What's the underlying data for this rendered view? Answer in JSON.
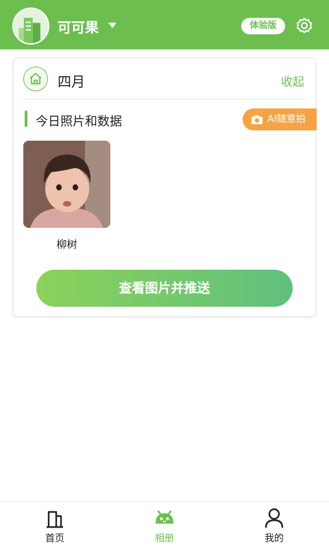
{
  "header": {
    "app_name": "可可果",
    "version_badge": "体验版"
  },
  "card": {
    "month_title": "四月",
    "collapse_label": "收起",
    "section_title": "今日照片和数据",
    "ai_button_label": "AI随意拍",
    "photos": [
      {
        "caption": "柳树"
      }
    ],
    "view_button_label": "查看图片并推送"
  },
  "bottom_nav": {
    "items": [
      {
        "label": "首页",
        "icon": "building-icon",
        "active": false
      },
      {
        "label": "相册",
        "icon": "mascot-icon",
        "active": true
      },
      {
        "label": "我的",
        "icon": "person-icon",
        "active": false
      }
    ]
  },
  "colors": {
    "brand_green": "#6cbf4f",
    "accent_orange": "#f6a343"
  }
}
